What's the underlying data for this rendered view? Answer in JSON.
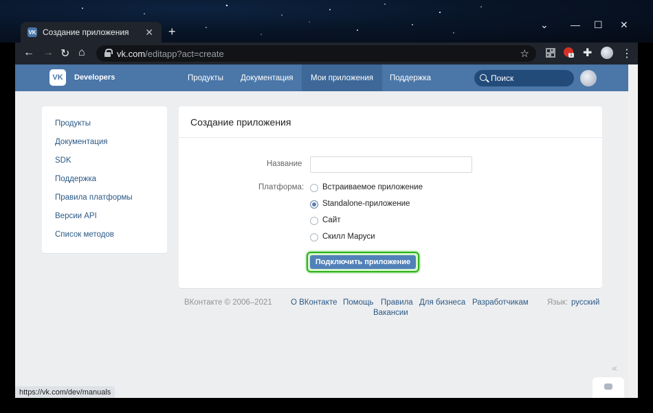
{
  "browser": {
    "tab_title": "Создание приложения",
    "tab_favicon": "VK",
    "url_host": "vk.com",
    "url_path": "/editapp?act=create",
    "ext_badge": "1",
    "status_url": "https://vk.com/dev/manuals"
  },
  "header": {
    "brand": "Developers",
    "logo_text": "VK",
    "nav": [
      "Продукты",
      "Документация",
      "Мои приложения",
      "Поддержка"
    ],
    "active_nav": "Мои приложения",
    "search_placeholder": "Поиск",
    "color": "#4a76a8"
  },
  "sidebar": {
    "items": [
      "Продукты",
      "Документация",
      "SDK",
      "Поддержка",
      "Правила платформы",
      "Версии API",
      "Список методов"
    ]
  },
  "form": {
    "title": "Создание приложения",
    "name_label": "Название",
    "name_value": "",
    "platform_label": "Платформа:",
    "options": [
      "Встраиваемое приложение",
      "Standalone-приложение",
      "Сайт",
      "Скилл Маруси"
    ],
    "selected_option": "Standalone-приложение",
    "submit_label": "Подключить приложение",
    "highlight_color": "#2db318"
  },
  "footer": {
    "copyright": "ВКонтакте © 2006–2021",
    "links": [
      "О ВКонтакте",
      "Помощь",
      "Правила",
      "Для бизнеса",
      "Разработчикам"
    ],
    "vacancies": "Вакансии",
    "language_label": "Язык:",
    "language_value": "русский"
  }
}
